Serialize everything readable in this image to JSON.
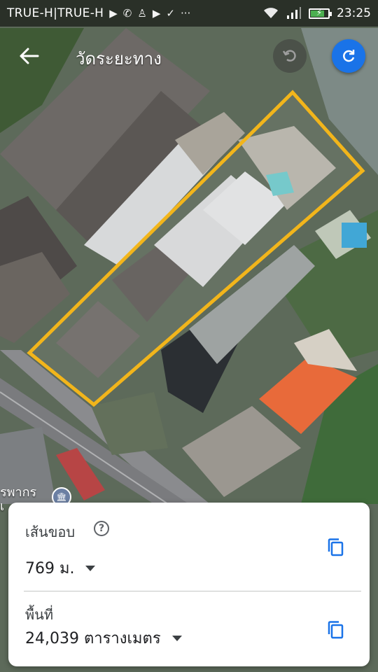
{
  "status_bar": {
    "carrier": "TRUE-H|TRUE-H",
    "notification_icons": [
      "youtube-icon",
      "phone-icon",
      "bag-icon",
      "youtube-icon",
      "check-icon",
      "more-dots-icon"
    ],
    "time": "23:25",
    "battery_level": 0.8
  },
  "app_bar": {
    "title": "วัดระยะทาง",
    "back_icon": "arrow-left-icon",
    "undo_icon": "undo-icon",
    "refresh_icon": "refresh-icon"
  },
  "map": {
    "place_label_line1": "รพากร",
    "place_label_line2": "เ",
    "polygon_color": "#f2b51b"
  },
  "measurement": {
    "perimeter_label": "เส้นขอบ",
    "perimeter_value": "769 ม.",
    "area_label": "พื้นที่",
    "area_value": "24,039 ตารางเมตร",
    "help_symbol": "?"
  },
  "colors": {
    "accent": "#1a73e8",
    "copy_icon": "#1a73e8"
  }
}
